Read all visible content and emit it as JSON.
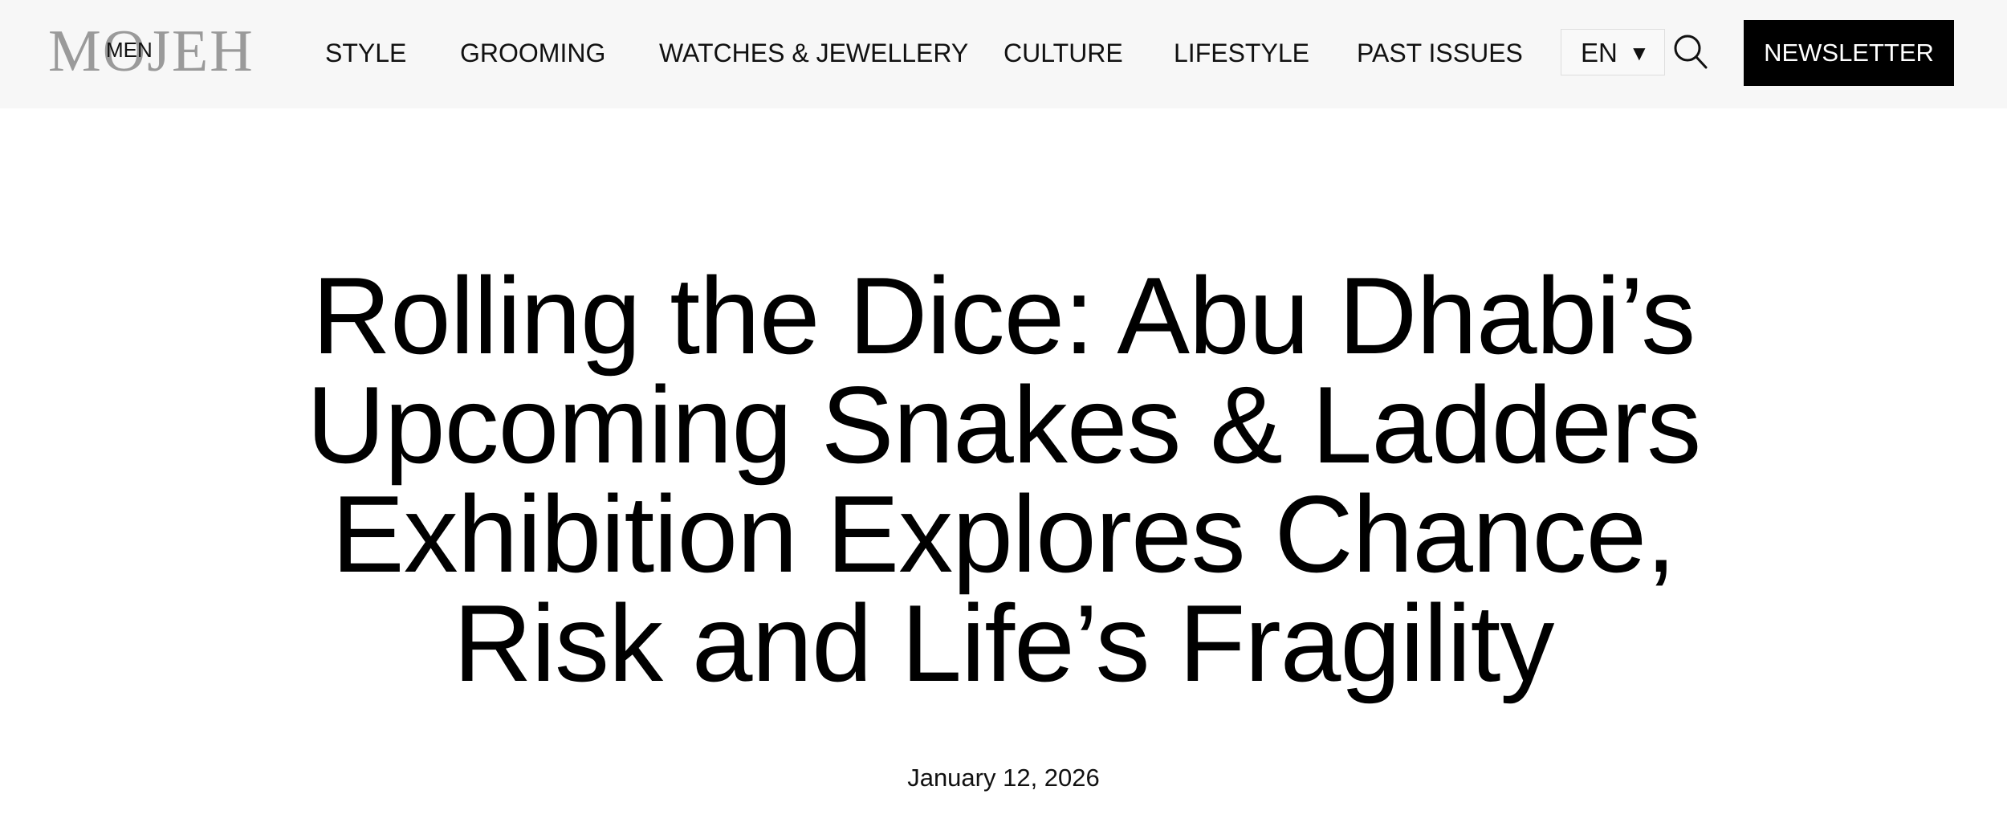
{
  "header": {
    "logo_word": "MOJEH",
    "logo_sub": "MEN",
    "nav": [
      {
        "label": "STYLE"
      },
      {
        "label": "GROOMING"
      },
      {
        "label": "WATCHES & JEWELLERY"
      },
      {
        "label": "CULTURE"
      },
      {
        "label": "LIFESTYLE"
      },
      {
        "label": "PAST ISSUES"
      }
    ],
    "language": "EN",
    "language_caret_icon": "caret-down-icon",
    "search_icon": "search-icon",
    "newsletter_label": "NEWSLETTER"
  },
  "article": {
    "title_lines": [
      "Rolling the Dice: Abu Dhabi’s",
      "Upcoming Snakes & Ladders",
      "Exhibition Explores Chance,",
      "Risk and Life’s Fragility"
    ],
    "date": "January 12, 2026"
  },
  "colors": {
    "header_bg": "#f7f7f7",
    "button_bg": "#000000",
    "button_text": "#ffffff",
    "logo_grey": "#9a9a9a"
  }
}
